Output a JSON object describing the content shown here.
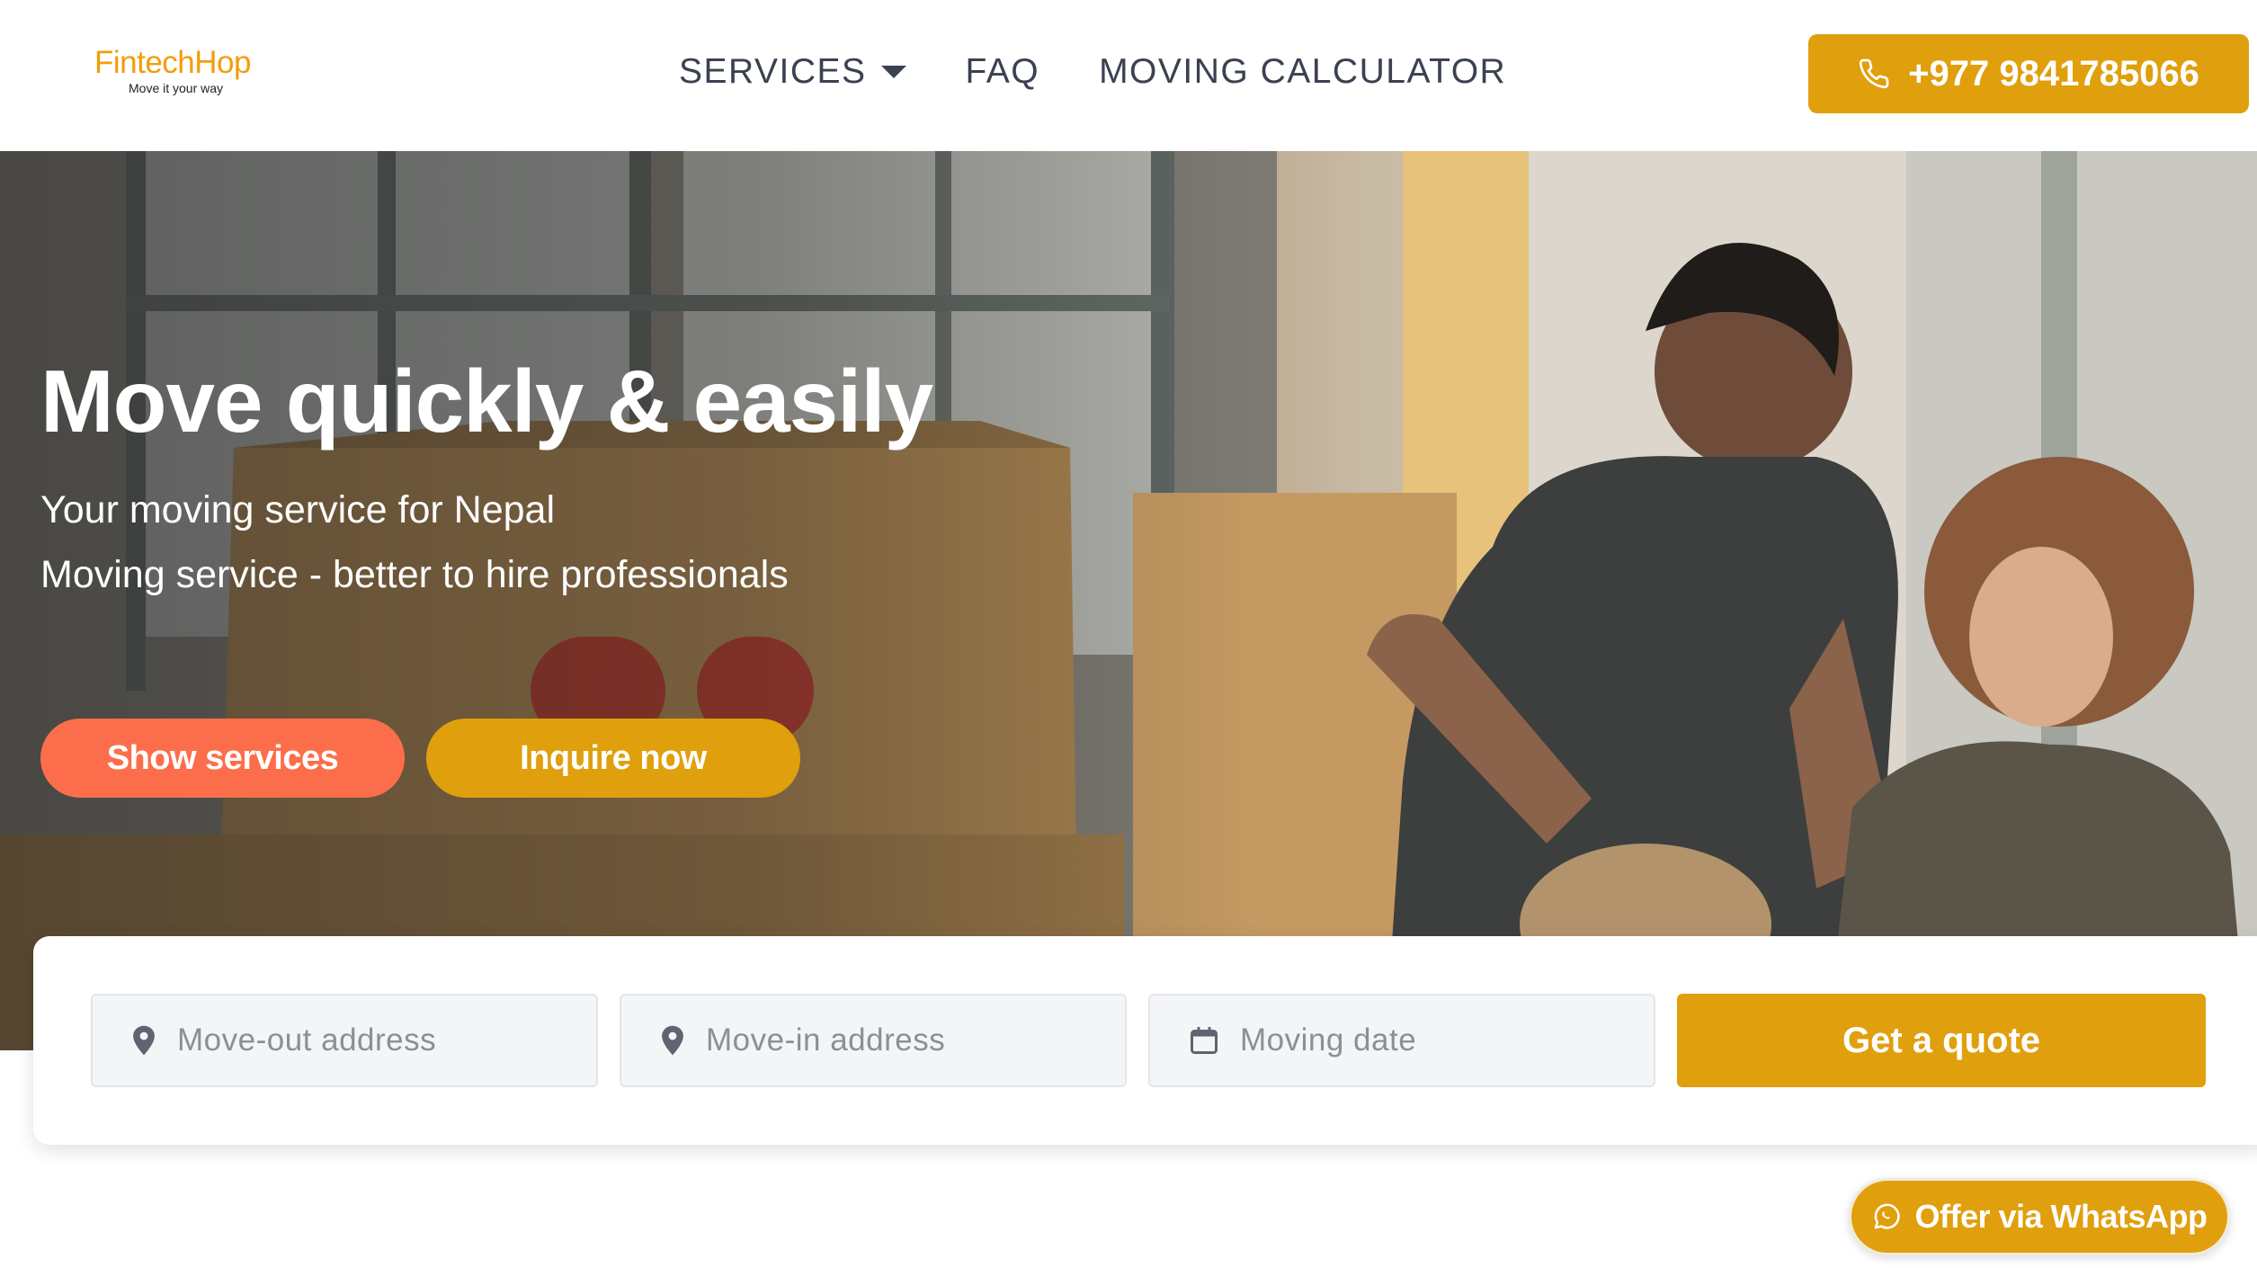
{
  "brand": {
    "name": "FintechHop",
    "tagline": "Move it your way",
    "accent": "#e09f0c",
    "logo_color": "#f29d0c",
    "secondary": "#fc6e4b"
  },
  "nav": {
    "items": [
      {
        "label": "SERVICES",
        "has_dropdown": true
      },
      {
        "label": "FAQ"
      },
      {
        "label": "MOVING CALCULATOR"
      }
    ]
  },
  "header": {
    "phone": "+977 9841785066",
    "phone_icon": "phone-icon"
  },
  "hero": {
    "title": "Move quickly & easily",
    "subtitle_1": "Your moving service for Nepal",
    "subtitle_2": "Moving service - better to hire professionals",
    "primary_button": "Show services",
    "secondary_button": "Inquire now"
  },
  "search": {
    "move_out": {
      "placeholder": "Move-out address",
      "icon": "map-pin-icon"
    },
    "move_in": {
      "placeholder": "Move-in address",
      "icon": "map-pin-icon"
    },
    "date": {
      "placeholder": "Moving date",
      "icon": "calendar-icon"
    },
    "submit": "Get a quote"
  },
  "whatsapp": {
    "label": "Offer via WhatsApp",
    "icon": "whatsapp-icon"
  }
}
